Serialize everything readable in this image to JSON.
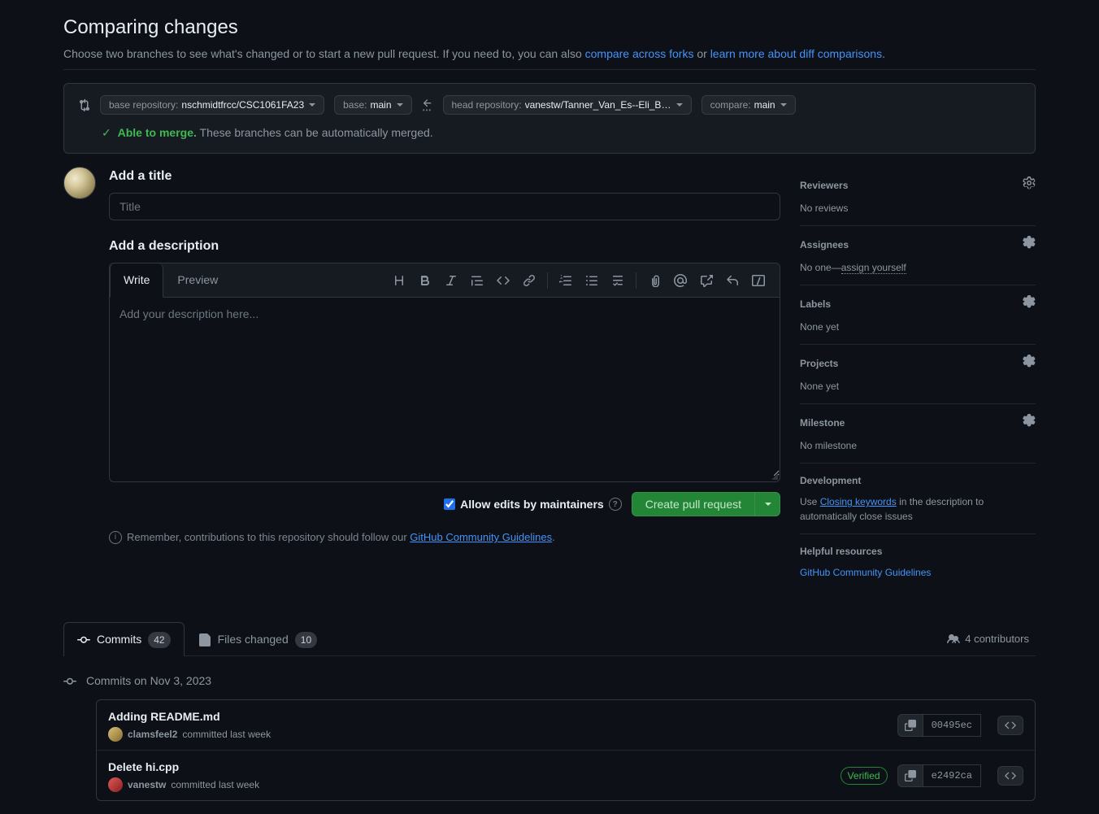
{
  "header": {
    "title": "Comparing changes",
    "description_pre": "Choose two branches to see what's changed or to start a new pull request. If you need to, you can also ",
    "link_forks": "compare across forks",
    "description_mid": " or ",
    "link_learn": "learn more about diff comparisons",
    "description_post": "."
  },
  "range": {
    "base_repo_label": "base repository: ",
    "base_repo_value": "nschmidtfrcc/CSC1061FA23",
    "base_branch_label": "base: ",
    "base_branch_value": "main",
    "head_repo_label": "head repository: ",
    "head_repo_value": "vanestw/Tanner_Van_Es--Eli_Bl...",
    "compare_label": "compare: ",
    "compare_value": "main",
    "merge_status": "Able to merge.",
    "merge_desc": "These branches can be automatically merged."
  },
  "form": {
    "title_label": "Add a title",
    "title_placeholder": "Title",
    "desc_label": "Add a description",
    "tab_write": "Write",
    "tab_preview": "Preview",
    "desc_placeholder": "Add your description here...",
    "allow_edits_label": "Allow edits by maintainers",
    "create_button": "Create pull request",
    "remember_pre": "Remember, contributions to this repository should follow our ",
    "guidelines_link": "GitHub Community Guidelines",
    "remember_post": "."
  },
  "sidebar": {
    "reviewers": {
      "title": "Reviewers",
      "body": "No reviews"
    },
    "assignees": {
      "title": "Assignees",
      "body_pre": "No one—",
      "assign_link": "assign yourself"
    },
    "labels": {
      "title": "Labels",
      "body": "None yet"
    },
    "projects": {
      "title": "Projects",
      "body": "None yet"
    },
    "milestone": {
      "title": "Milestone",
      "body": "No milestone"
    },
    "development": {
      "title": "Development",
      "body_pre": "Use ",
      "link": "Closing keywords",
      "body_post": " in the description to automatically close issues"
    },
    "resources": {
      "title": "Helpful resources",
      "link": "GitHub Community Guidelines"
    }
  },
  "tabs": {
    "commits_label": "Commits",
    "commits_count": "42",
    "files_label": "Files changed",
    "files_count": "10",
    "contributors": "4 contributors"
  },
  "timeline": {
    "date_header": "Commits on Nov 3, 2023",
    "commits": [
      {
        "title": "Adding README.md",
        "author": "clamsfeel2",
        "time": "committed last week",
        "sha": "00495ec",
        "verified": false
      },
      {
        "title": "Delete hi.cpp",
        "author": "vanestw",
        "time": "committed last week",
        "sha": "e2492ca",
        "verified": true
      }
    ]
  }
}
